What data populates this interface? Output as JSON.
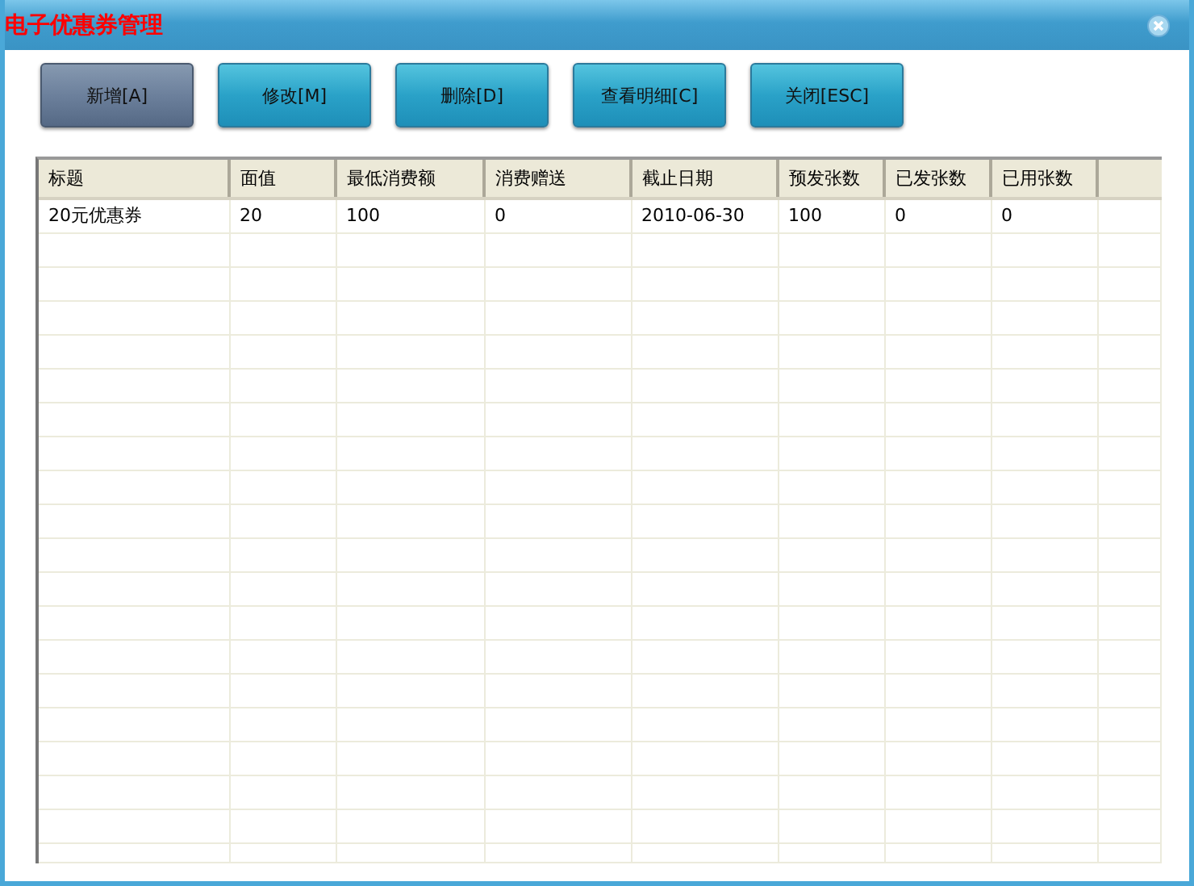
{
  "window": {
    "title": "电子优惠券管理"
  },
  "buttons": [
    {
      "label": "新增[A]",
      "selected": true
    },
    {
      "label": "修改[M]",
      "selected": false
    },
    {
      "label": "删除[D]",
      "selected": false
    },
    {
      "label": "查看明细[C]",
      "selected": false
    },
    {
      "label": "关闭[ESC]",
      "selected": false
    }
  ],
  "table": {
    "columns": [
      "标题",
      "面值",
      "最低消费额",
      "消费赠送",
      "截止日期",
      "预发张数",
      "已发张数",
      "已用张数"
    ],
    "rows": [
      [
        "20元优惠券",
        "20",
        "100",
        "0",
        "2010-06-30",
        "100",
        "0",
        "0"
      ]
    ]
  }
}
